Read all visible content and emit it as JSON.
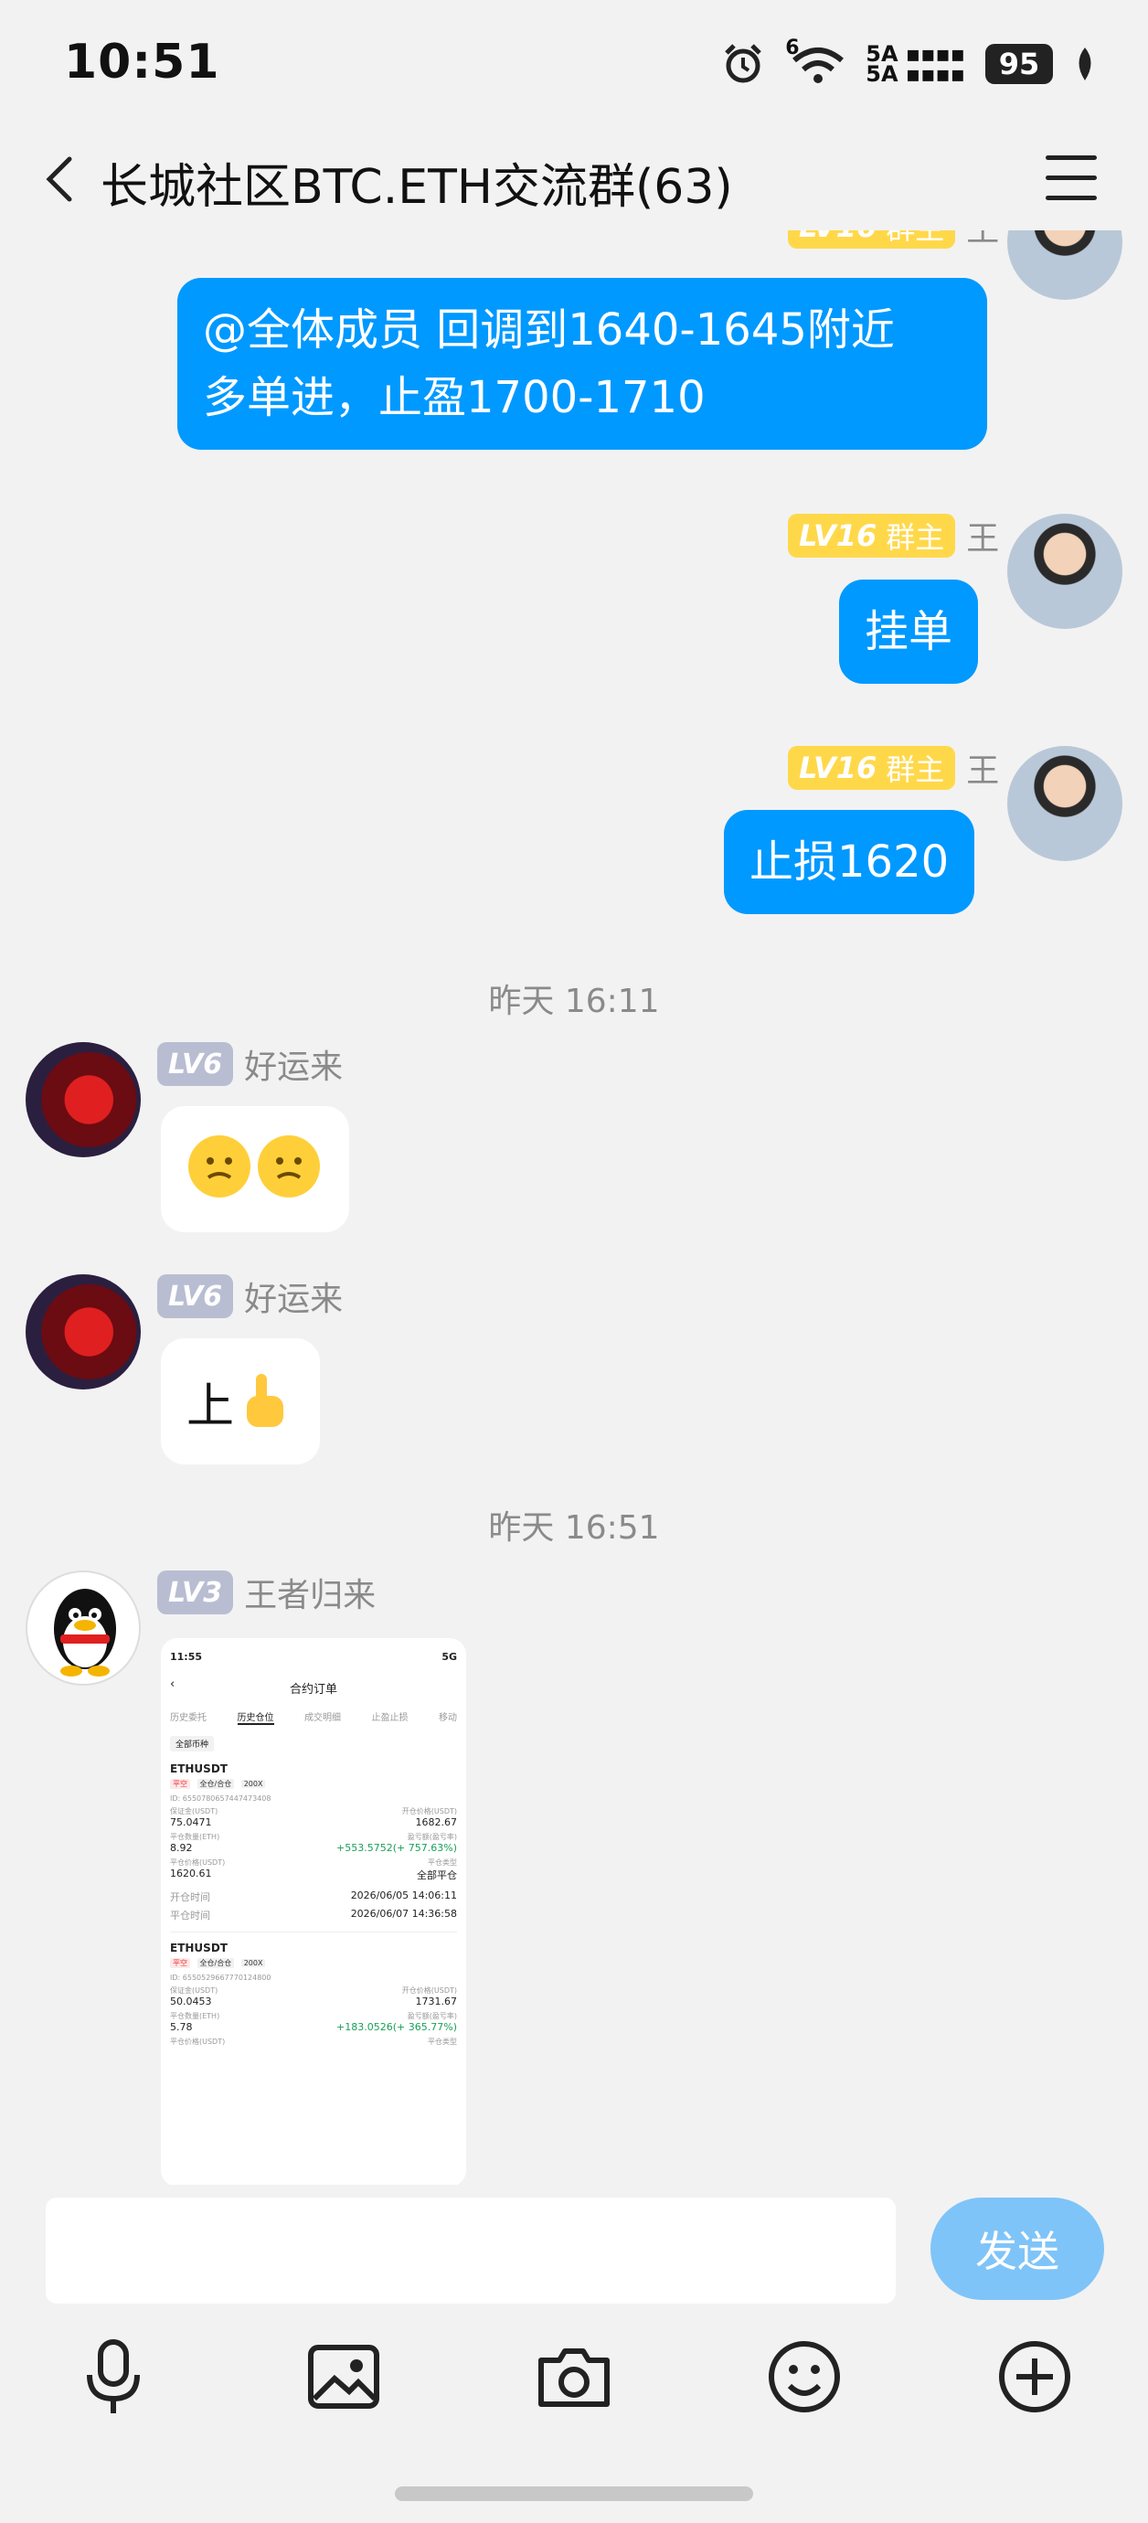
{
  "status_bar": {
    "time": "10:51",
    "signal_top": "5A",
    "signal_bottom": "5A",
    "wifi_badge": "6",
    "battery": "95"
  },
  "header": {
    "title": "长城社区BTC.ETH交流群(63)"
  },
  "owner_badge": {
    "level": "LV16",
    "role": "群主"
  },
  "messages": [
    {
      "sender": "王",
      "text_line1": "@全体成员 回调到1640-1645附近",
      "text_line2": "多单进，止盈1700-1710"
    },
    {
      "sender": "王",
      "text": "挂单"
    },
    {
      "sender": "王",
      "text": "止损1620"
    }
  ],
  "timestamps": [
    "昨天 16:11",
    "昨天 16:51"
  ],
  "member_messages": [
    {
      "level": "LV6",
      "sender": "好运来",
      "content": "emoji"
    },
    {
      "level": "LV6",
      "sender": "好运来",
      "text": "上"
    },
    {
      "level": "LV3",
      "sender": "王者归来",
      "content": "image"
    }
  ],
  "embedded_screenshot": {
    "time": "11:55",
    "network": "5G",
    "title": "合约订单",
    "tabs": [
      "历史委托",
      "历史仓位",
      "成交明细",
      "止盈止损",
      "移动"
    ],
    "filter": "全部币种",
    "orders": [
      {
        "symbol": "ETHUSDT",
        "tags": [
          "平空",
          "全仓/合仓",
          "200X"
        ],
        "id": "ID: 6550780657447473408",
        "margin_label": "保证金(USDT)",
        "margin": "75.0471",
        "open_price_label": "开仓价格(USDT)",
        "open_price": "1682.67",
        "qty_label": "平仓数量(ETH)",
        "qty": "8.92",
        "pnl_label": "盈亏额(盈亏率)",
        "pnl": "+553.5752(+ 757.63%)",
        "close_price_label": "平仓价格(USDT)",
        "close_price": "1620.61",
        "close_type_label": "平仓类型",
        "close_type": "全部平仓",
        "open_time_label": "开仓时间",
        "open_time": "2026/06/05 14:06:11",
        "close_time_label": "平仓时间",
        "close_time": "2026/06/07 14:36:58"
      },
      {
        "symbol": "ETHUSDT",
        "tags": [
          "平空",
          "全仓/合仓",
          "200X"
        ],
        "id": "ID: 6550529667770124800",
        "margin_label": "保证金(USDT)",
        "margin": "50.0453",
        "open_price_label": "开仓价格(USDT)",
        "open_price": "1731.67",
        "qty_label": "平仓数量(ETH)",
        "qty": "5.78",
        "pnl_label": "盈亏额(盈亏率)",
        "pnl": "+183.0526(+ 365.77%)",
        "close_price_label": "平仓价格(USDT)",
        "close_type_label": "平仓类型"
      }
    ]
  },
  "input_bar": {
    "placeholder": "",
    "send_label": "发送",
    "tools": [
      "microphone-icon",
      "image-icon",
      "camera-icon",
      "emoji-icon",
      "plus-icon"
    ]
  },
  "colors": {
    "accent_blue": "#0099ff",
    "send_disabled": "#7fc4f8",
    "owner_badge": "#ffd84a",
    "level_badge": "#b9bdd2",
    "background": "#f2f2f2"
  }
}
